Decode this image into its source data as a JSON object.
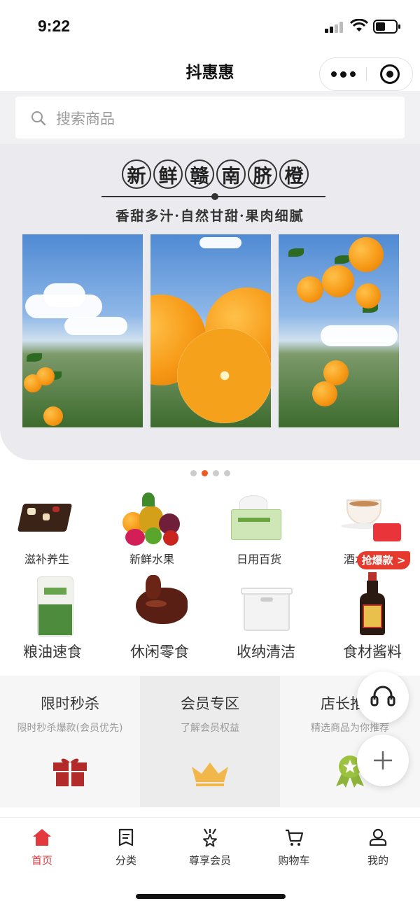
{
  "status_bar": {
    "time": "9:22"
  },
  "nav": {
    "title": "抖惠惠"
  },
  "search": {
    "placeholder": "搜索商品"
  },
  "banner": {
    "title_chars": [
      "新",
      "鲜",
      "赣",
      "南",
      "脐",
      "橙"
    ],
    "subtitle": "香甜多汁·自然甘甜·果肉细腻",
    "pager_total": 4,
    "pager_active": 2
  },
  "categories": [
    {
      "label": "滋补养生",
      "icon": "snack-icon"
    },
    {
      "label": "新鲜水果",
      "icon": "fruit-basket-icon"
    },
    {
      "label": "日用百货",
      "icon": "tissue-box-icon"
    },
    {
      "label": "酒水饮品",
      "icon": "coffee-cup-icon"
    },
    {
      "label": "粮油速食",
      "icon": "rice-bag-icon"
    },
    {
      "label": "休闲零食",
      "icon": "roast-duck-icon"
    },
    {
      "label": "收纳清洁",
      "icon": "storage-box-icon"
    },
    {
      "label": "食材酱料",
      "icon": "soy-sauce-icon"
    }
  ],
  "grab_badge": "抢爆款 >",
  "promos": [
    {
      "title": "限时秒杀",
      "subtitle": "限时秒杀爆款(会员优先)",
      "icon": "gift-icon"
    },
    {
      "title": "会员专区",
      "subtitle": "了解会员权益",
      "icon": "crown-icon"
    },
    {
      "title": "店长推荐",
      "subtitle": "精选商品为你推荐",
      "icon": "award-ribbon-icon"
    }
  ],
  "tabbar": [
    {
      "label": "首页",
      "icon": "home-icon",
      "active": true
    },
    {
      "label": "分类",
      "icon": "list-doc-icon",
      "active": false
    },
    {
      "label": "尊享会员",
      "icon": "vip-star-icon",
      "active": false
    },
    {
      "label": "购物车",
      "icon": "cart-icon",
      "active": false
    },
    {
      "label": "我的",
      "icon": "user-icon",
      "active": false
    }
  ],
  "colors": {
    "accent": "#e4393c",
    "pager_active": "#ee5a24",
    "badge": "#e53a2d"
  }
}
